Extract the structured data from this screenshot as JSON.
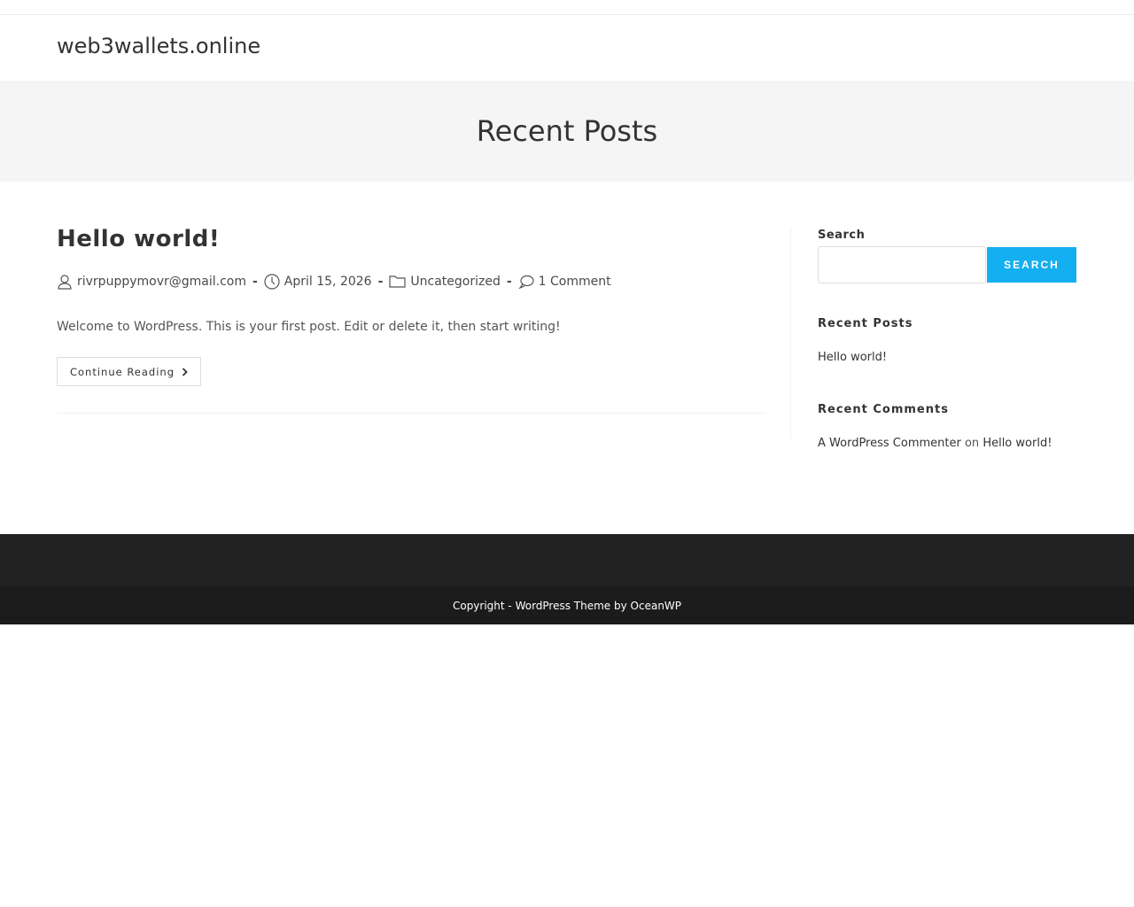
{
  "site": {
    "title": "web3wallets.online"
  },
  "page_header": {
    "title": "Recent Posts"
  },
  "post": {
    "title": "Hello world!",
    "author": "rivrpuppymovr@gmail.com",
    "date": "April 15, 2026",
    "category": "Uncategorized",
    "comments": "1 Comment",
    "separator": "-",
    "excerpt": "Welcome to WordPress. This is your first post. Edit or delete it, then start writing!",
    "continue_label": "Continue Reading"
  },
  "sidebar": {
    "search_heading": "Search",
    "search_value": "",
    "search_button": "SEARCH",
    "recent_posts_heading": "Recent Posts",
    "recent_posts": [
      "Hello world!"
    ],
    "recent_comments_heading": "Recent Comments",
    "recent_comment": {
      "author": "A WordPress Commenter",
      "on": "on",
      "post": "Hello world!"
    }
  },
  "footer": {
    "copyright": "Copyright - WordPress Theme by OceanWP"
  },
  "colors": {
    "accent": "#13aff0",
    "footer_bg": "#222222",
    "bottom_bg": "#1b1b1b",
    "header_band": "#f5f5f5"
  }
}
